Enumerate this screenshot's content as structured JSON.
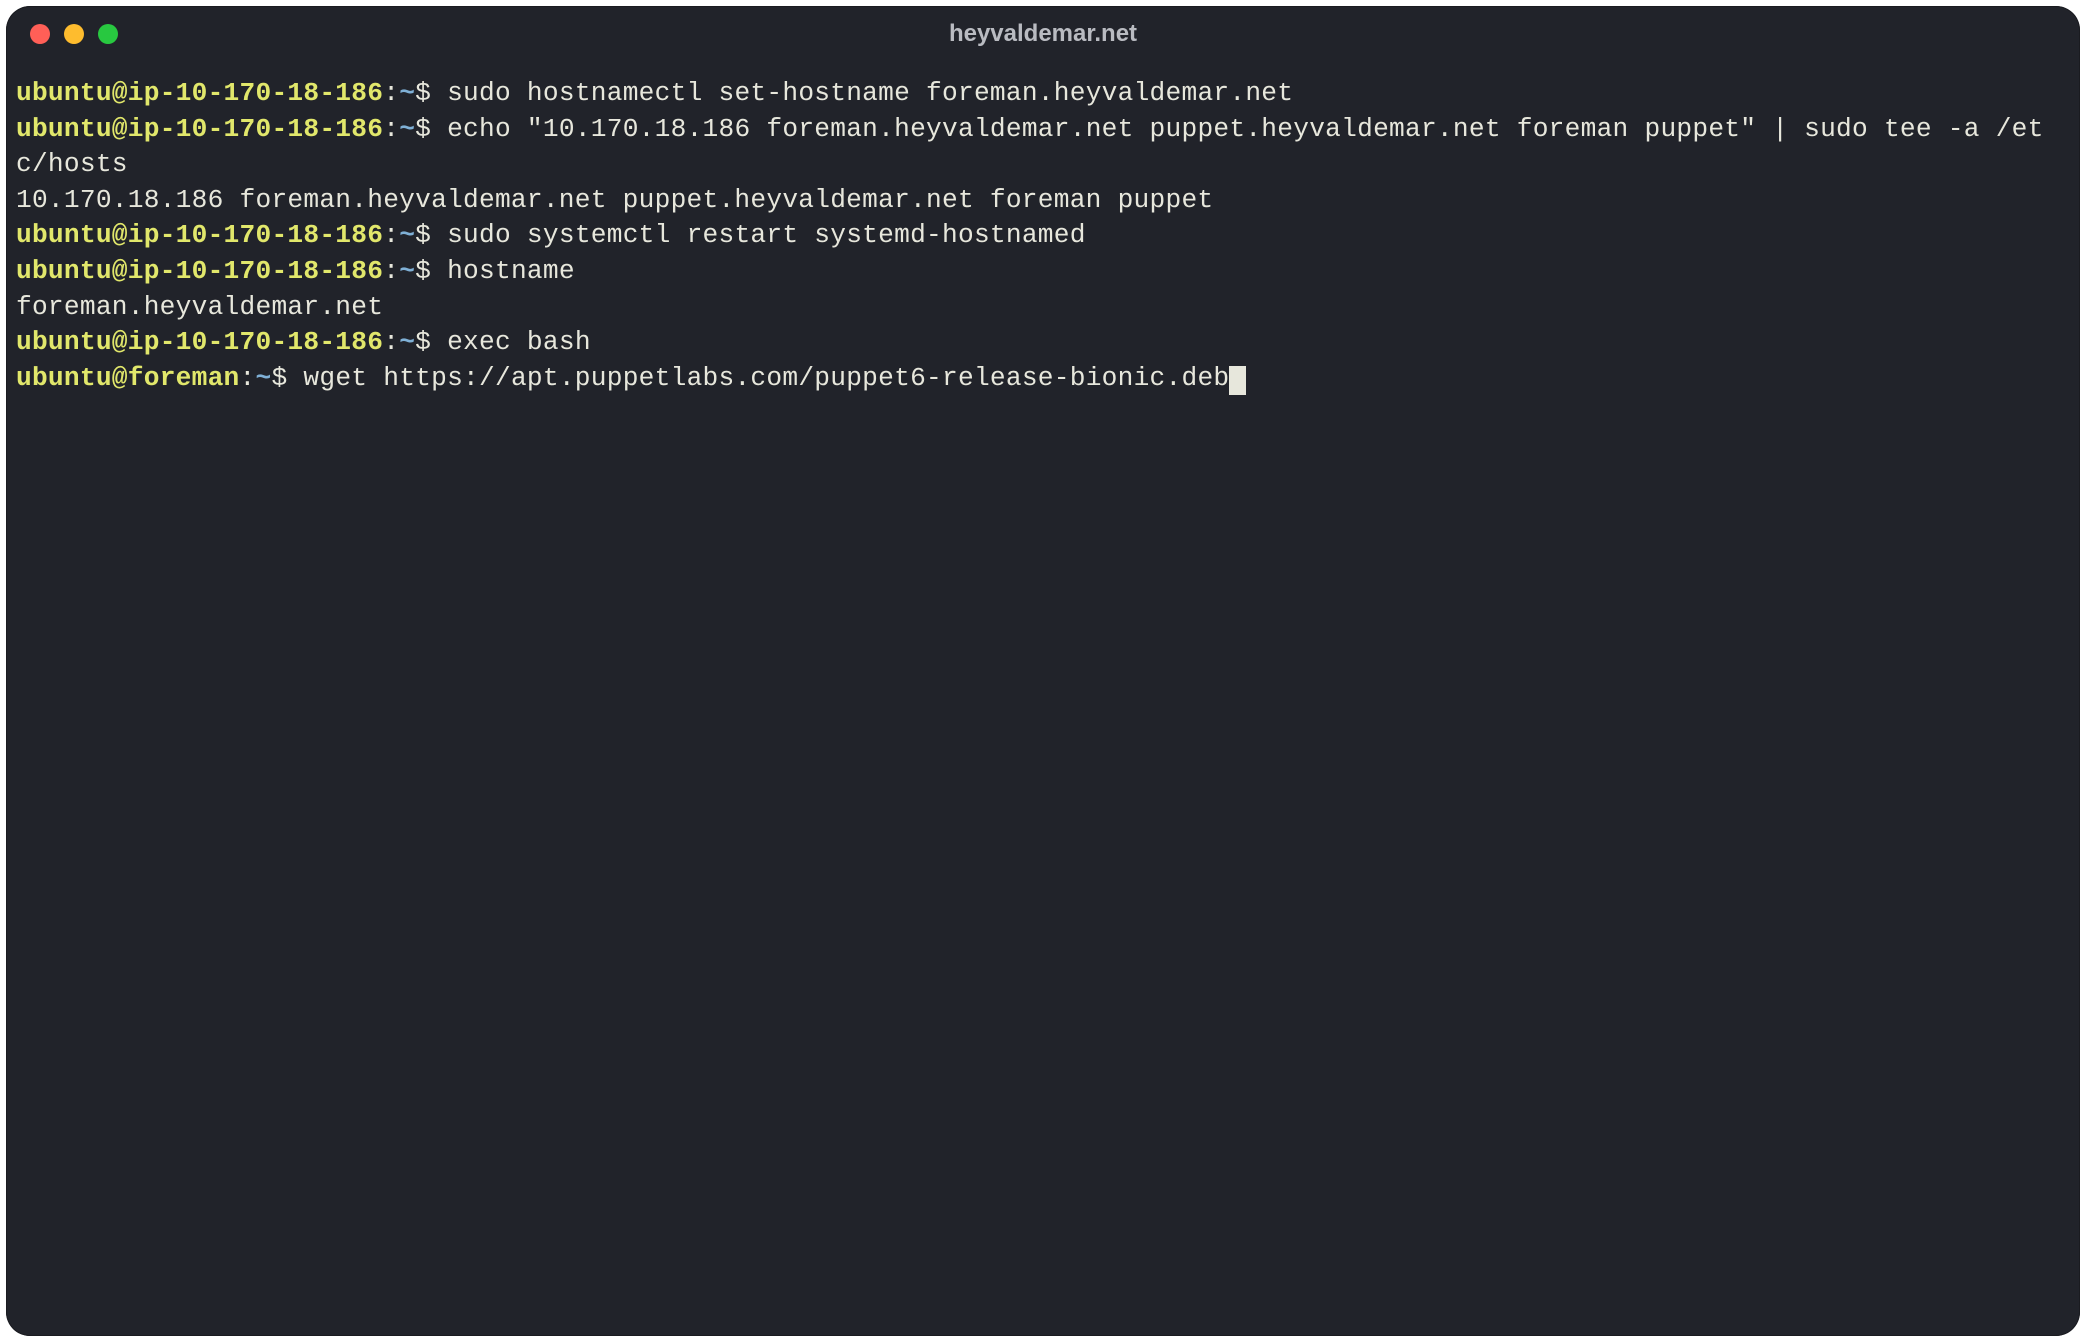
{
  "window": {
    "title": "heyvaldemar.net"
  },
  "session": {
    "lines": [
      {
        "type": "prompt",
        "user": "ubuntu",
        "host": "ip-10-170-18-186",
        "path": "~",
        "cmd": "sudo hostnamectl set-hostname foreman.heyvaldemar.net"
      },
      {
        "type": "prompt",
        "user": "ubuntu",
        "host": "ip-10-170-18-186",
        "path": "~",
        "cmd": "echo \"10.170.18.186 foreman.heyvaldemar.net puppet.heyvaldemar.net foreman puppet\" | sudo tee -a /etc/hosts"
      },
      {
        "type": "output",
        "text": "10.170.18.186 foreman.heyvaldemar.net puppet.heyvaldemar.net foreman puppet"
      },
      {
        "type": "prompt",
        "user": "ubuntu",
        "host": "ip-10-170-18-186",
        "path": "~",
        "cmd": "sudo systemctl restart systemd-hostnamed"
      },
      {
        "type": "prompt",
        "user": "ubuntu",
        "host": "ip-10-170-18-186",
        "path": "~",
        "cmd": "hostname"
      },
      {
        "type": "output",
        "text": "foreman.heyvaldemar.net"
      },
      {
        "type": "prompt",
        "user": "ubuntu",
        "host": "ip-10-170-18-186",
        "path": "~",
        "cmd": "exec bash"
      },
      {
        "type": "prompt",
        "user": "ubuntu",
        "host": "foreman",
        "path": "~",
        "cmd": "wget https://apt.puppetlabs.com/puppet6-release-bionic.deb",
        "cursor": true
      }
    ]
  }
}
